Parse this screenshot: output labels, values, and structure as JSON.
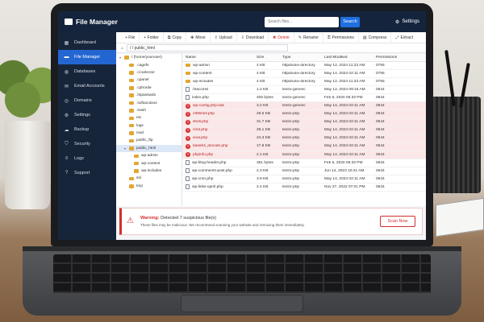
{
  "header": {
    "app_title": "File Manager",
    "search_placeholder": "Search files...",
    "search_button": "Search",
    "settings_label": "Settings"
  },
  "sidebar": {
    "items": [
      {
        "label": "Dashboard",
        "icon": "grid-icon"
      },
      {
        "label": "File Manager",
        "icon": "folder-icon",
        "active": true
      },
      {
        "label": "Databases",
        "icon": "database-icon"
      },
      {
        "label": "Email Accounts",
        "icon": "mail-icon"
      },
      {
        "label": "Domains",
        "icon": "globe-icon"
      },
      {
        "label": "Settings",
        "icon": "gear-icon"
      },
      {
        "label": "Backup",
        "icon": "backup-icon"
      },
      {
        "label": "Security",
        "icon": "shield-icon"
      },
      {
        "label": "Logs",
        "icon": "logs-icon"
      },
      {
        "label": "Support",
        "icon": "help-icon"
      }
    ]
  },
  "toolbar": {
    "file": "+ File",
    "folder": "+ Folder",
    "copy": "Copy",
    "move": "Move",
    "upload": "Upload",
    "download": "Download",
    "delete": "Delete",
    "rename": "Rename",
    "permissions": "Permissions",
    "compress": "Compress",
    "extract": "Extract"
  },
  "path": {
    "home": "/",
    "current": "/ public_html"
  },
  "tree": [
    {
      "label": "/ (home/youruser)",
      "level": 0,
      "arrow": "▾"
    },
    {
      "label": ".cagefs",
      "level": 1
    },
    {
      "label": ".cl.selector",
      "level": 1
    },
    {
      "label": ".cpanel",
      "level": 1
    },
    {
      "label": ".cphorde",
      "level": 1
    },
    {
      "label": ".htpasswds",
      "level": 1
    },
    {
      "label": ".softaculous",
      "level": 1
    },
    {
      "label": ".trash",
      "level": 1
    },
    {
      "label": "etc",
      "level": 1
    },
    {
      "label": "logs",
      "level": 1
    },
    {
      "label": "mail",
      "level": 1
    },
    {
      "label": "public_ftp",
      "level": 1
    },
    {
      "label": "public_html",
      "level": 1,
      "arrow": "▾",
      "selected": true
    },
    {
      "label": "wp-admin",
      "level": 2
    },
    {
      "label": "wp-content",
      "level": 2
    },
    {
      "label": "wp-includes",
      "level": 2
    },
    {
      "label": "ssl",
      "level": 1
    },
    {
      "label": "tmp",
      "level": 1
    }
  ],
  "columns": {
    "name": "Name",
    "size": "Size",
    "type": "Type",
    "modified": "Last Modified",
    "permissions": "Permissions"
  },
  "files": [
    {
      "name": "wp-admin",
      "size": "4 KB",
      "type": "httpd/unix-directory",
      "modified": "May 12, 2024 11:23 AM",
      "perm": "0755",
      "kind": "folder"
    },
    {
      "name": "wp-content",
      "size": "4 KB",
      "type": "httpd/unix-directory",
      "modified": "May 14, 2024 02:11 AM",
      "perm": "0755",
      "kind": "folder"
    },
    {
      "name": "wp-includes",
      "size": "4 KB",
      "type": "httpd/unix-directory",
      "modified": "May 12, 2024 11:23 AM",
      "perm": "0755",
      "kind": "folder"
    },
    {
      "name": ".htaccess",
      "size": "1.2 KB",
      "type": "text/x-generic",
      "modified": "May 12, 2024 09:15 AM",
      "perm": "0644",
      "kind": "file"
    },
    {
      "name": "index.php",
      "size": "405 bytes",
      "type": "text/x-generic",
      "modified": "Feb 6, 2020 06:33 PM",
      "perm": "0644",
      "kind": "file"
    },
    {
      "name": "wp-config.php.bak",
      "size": "3.2 KB",
      "type": "text/x-generic",
      "modified": "May 14, 2024 02:11 AM",
      "perm": "0644",
      "kind": "warn"
    },
    {
      "name": "c99shell.php",
      "size": "28.5 KB",
      "type": "text/x-php",
      "modified": "May 14, 2024 02:11 AM",
      "perm": "0644",
      "kind": "warn"
    },
    {
      "name": "shell.php",
      "size": "31.7 KB",
      "type": "text/x-php",
      "modified": "May 14, 2024 02:11 AM",
      "perm": "0644",
      "kind": "warn"
    },
    {
      "name": "cmd.php",
      "size": "29.1 KB",
      "type": "text/x-php",
      "modified": "May 14, 2024 02:11 AM",
      "perm": "0644",
      "kind": "warn"
    },
    {
      "name": "eval.php",
      "size": "24.3 KB",
      "type": "text/x-php",
      "modified": "May 14, 2024 02:11 AM",
      "perm": "0644",
      "kind": "warn"
    },
    {
      "name": "base64_decode.php",
      "size": "17.8 KB",
      "type": "text/x-php",
      "modified": "May 14, 2024 02:11 AM",
      "perm": "0644",
      "kind": "warn"
    },
    {
      "name": "phpinfo.php",
      "size": "2.1 KB",
      "type": "text/x-php",
      "modified": "May 14, 2024 02:11 AM",
      "perm": "0644",
      "kind": "warn"
    },
    {
      "name": "wp-blog-header.php",
      "size": "351 bytes",
      "type": "text/x-php",
      "modified": "Feb 6, 2020 06:33 PM",
      "perm": "0644",
      "kind": "file"
    },
    {
      "name": "wp-comments-post.php",
      "size": "2.3 KB",
      "type": "text/x-php",
      "modified": "Jun 14, 2023 10:21 AM",
      "perm": "0644",
      "kind": "file"
    },
    {
      "name": "wp-cron.php",
      "size": "3.9 KB",
      "type": "text/x-php",
      "modified": "May 14, 2024 02:11 AM",
      "perm": "0644",
      "kind": "file"
    },
    {
      "name": "wp-links-opml.php",
      "size": "2.4 KB",
      "type": "text/x-php",
      "modified": "Nov 27, 2022 07:01 PM",
      "perm": "0644",
      "kind": "file"
    }
  ],
  "warning": {
    "label": "Warning:",
    "title": "Detected 7 suspicious file(s)",
    "message": "These files may be malicious. We recommend scanning your website and removing them immediately.",
    "button": "Scan Now"
  },
  "colors": {
    "header": "#14243d",
    "sidebar": "#17253b",
    "accent": "#2366d1",
    "danger": "#d32f2f",
    "suspicious_row": "#fbe7e7"
  }
}
